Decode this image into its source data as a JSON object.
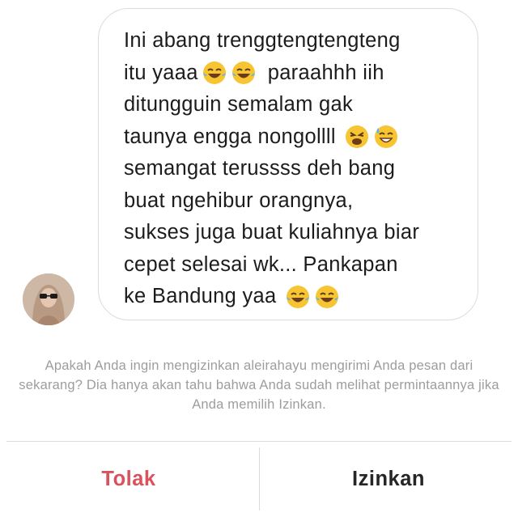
{
  "message": {
    "lines": [
      {
        "text": "Ini abang trenggtengtengteng",
        "emojis": [],
        "trailing": ""
      },
      {
        "text": "itu yaaa",
        "emojis": [
          "face-with-tears-of-joy",
          "face-with-tears-of-joy"
        ],
        "trailing": "paraahhh iih"
      },
      {
        "text": "ditungguin semalam gak",
        "emojis": [],
        "trailing": ""
      },
      {
        "text": "taunya engga nongollll",
        "emojis": [
          "weary-face",
          "grinning-face-with-sweat"
        ],
        "trailing": ""
      },
      {
        "text": "semangat terussss deh bang",
        "emojis": [],
        "trailing": ""
      },
      {
        "text": "buat ngehibur orangnya,",
        "emojis": [],
        "trailing": ""
      },
      {
        "text": "sukses juga buat kuliahnya biar",
        "emojis": [],
        "trailing": ""
      },
      {
        "text": "cepet selesai wk... Pankapan",
        "emojis": [],
        "trailing": ""
      },
      {
        "text": "ke Bandung yaa",
        "emojis": [
          "face-with-tears-of-joy",
          "face-with-tears-of-joy"
        ],
        "trailing": ""
      }
    ]
  },
  "sender": {
    "avatar": "avatar-photo"
  },
  "request": {
    "prompt": "Apakah Anda ingin mengizinkan aleirahayu mengirimi Anda pesan dari sekarang? Dia hanya akan tahu bahwa Anda sudah melihat permintaannya jika Anda memilih Izinkan."
  },
  "actions": {
    "decline_label": "Tolak",
    "accept_label": "Izinkan"
  },
  "colors": {
    "decline": "#d9535f",
    "accept": "#262626",
    "prompt_text": "#9d9d9d",
    "message_text": "#1c1c1c",
    "bubble_border": "#dcdcdc"
  }
}
